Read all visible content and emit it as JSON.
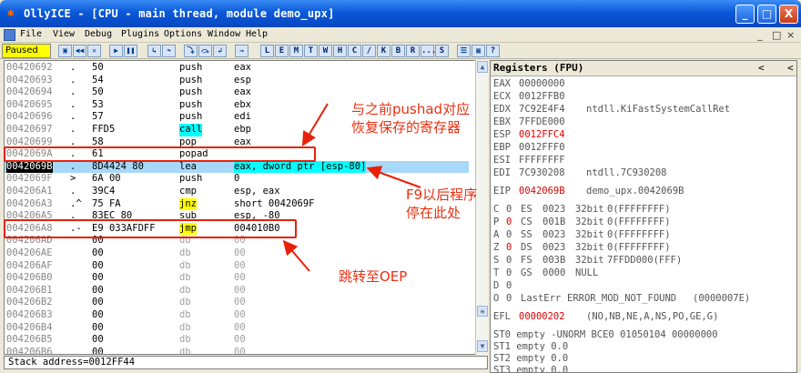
{
  "window": {
    "title": "OllyICE - [CPU - main thread, module demo_upx]",
    "min": "_",
    "max": "□",
    "close": "X"
  },
  "menu": {
    "items": [
      "File",
      "View",
      "Debug",
      "Plugins",
      "Options",
      "Window",
      "Help"
    ],
    "mdi_controls": [
      "_",
      "□",
      "×"
    ]
  },
  "toolbar": {
    "status": "Paused",
    "buttons": [
      "open",
      "restart",
      "close",
      "run",
      "pause",
      "step-into",
      "step-over",
      "trace-into",
      "trace-over",
      "execute-till-return",
      "go-to"
    ],
    "letters": [
      "L",
      "E",
      "M",
      "T",
      "W",
      "H",
      "C",
      "/",
      "K",
      "B",
      "R",
      "...",
      "S"
    ],
    "extra": [
      "list",
      "grid",
      "?"
    ]
  },
  "disasm": {
    "rows": [
      {
        "addr": "00420692",
        "mark": ".",
        "hex": "50",
        "mnem": "push",
        "ops": "eax"
      },
      {
        "addr": "00420693",
        "mark": ".",
        "hex": "54",
        "mnem": "push",
        "ops": "esp"
      },
      {
        "addr": "00420694",
        "mark": ".",
        "hex": "50",
        "mnem": "push",
        "ops": "eax"
      },
      {
        "addr": "00420695",
        "mark": ".",
        "hex": "53",
        "mnem": "push",
        "ops": "ebx"
      },
      {
        "addr": "00420696",
        "mark": ".",
        "hex": "57",
        "mnem": "push",
        "ops": "edi"
      },
      {
        "addr": "00420697",
        "mark": ".",
        "hex": "FFD5",
        "mnem": "call",
        "ops": "ebp"
      },
      {
        "addr": "00420699",
        "mark": ".",
        "hex": "58",
        "mnem": "pop",
        "ops": "eax"
      },
      {
        "addr": "0042069A",
        "mark": ".",
        "hex": "61",
        "mnem": "popad",
        "ops": ""
      },
      {
        "addr": "0042069B",
        "mark": ".",
        "hex": "8D4424 80",
        "mnem": "lea",
        "ops": "eax, dword ptr [esp-80]"
      },
      {
        "addr": "0042069F",
        "mark": ">",
        "hex": "6A 00",
        "mnem": "push",
        "ops": "0"
      },
      {
        "addr": "004206A1",
        "mark": ".",
        "hex": "39C4",
        "mnem": "cmp",
        "ops": "esp, eax"
      },
      {
        "addr": "004206A3",
        "mark": ".^",
        "hex": "75 FA",
        "mnem": "jnz",
        "ops": "short 0042069F"
      },
      {
        "addr": "004206A5",
        "mark": ".",
        "hex": "83EC 80",
        "mnem": "sub",
        "ops": "esp, -80"
      },
      {
        "addr": "004206A8",
        "mark": ".-",
        "hex": "E9 033AFDFF",
        "mnem": "jmp",
        "ops": "004010B0"
      },
      {
        "addr": "004206AD",
        "mark": "",
        "hex": "00",
        "mnem": "db",
        "ops": "00"
      },
      {
        "addr": "004206AE",
        "mark": "",
        "hex": "00",
        "mnem": "db",
        "ops": "00"
      },
      {
        "addr": "004206AF",
        "mark": "",
        "hex": "00",
        "mnem": "db",
        "ops": "00"
      },
      {
        "addr": "004206B0",
        "mark": "",
        "hex": "00",
        "mnem": "db",
        "ops": "00"
      },
      {
        "addr": "004206B1",
        "mark": "",
        "hex": "00",
        "mnem": "db",
        "ops": "00"
      },
      {
        "addr": "004206B2",
        "mark": "",
        "hex": "00",
        "mnem": "db",
        "ops": "00"
      },
      {
        "addr": "004206B3",
        "mark": "",
        "hex": "00",
        "mnem": "db",
        "ops": "00"
      },
      {
        "addr": "004206B4",
        "mark": "",
        "hex": "00",
        "mnem": "db",
        "ops": "00"
      },
      {
        "addr": "004206B5",
        "mark": "",
        "hex": "00",
        "mnem": "db",
        "ops": "00"
      },
      {
        "addr": "004206B6",
        "mark": "",
        "hex": "00",
        "mnem": "db",
        "ops": "00"
      }
    ]
  },
  "statusline": "Stack address=0012FF44",
  "registers": {
    "title": "Registers (FPU)",
    "nav_left": "<",
    "nav_right": "<",
    "gp": [
      {
        "name": "EAX",
        "value": "00000000",
        "comment": "",
        "changed": false
      },
      {
        "name": "ECX",
        "value": "0012FFB0",
        "comment": "",
        "changed": false
      },
      {
        "name": "EDX",
        "value": "7C92E4F4",
        "comment": "ntdll.KiFastSystemCallRet",
        "changed": false
      },
      {
        "name": "EBX",
        "value": "7FFDE000",
        "comment": "",
        "changed": false
      },
      {
        "name": "ESP",
        "value": "0012FFC4",
        "comment": "",
        "changed": true
      },
      {
        "name": "EBP",
        "value": "0012FFF0",
        "comment": "",
        "changed": false
      },
      {
        "name": "ESI",
        "value": "FFFFFFFF",
        "comment": "",
        "changed": false
      },
      {
        "name": "EDI",
        "value": "7C930208",
        "comment": "ntdll.7C930208",
        "changed": false
      }
    ],
    "eip": {
      "name": "EIP",
      "value": "0042069B",
      "comment": "demo_upx.0042069B"
    },
    "flags": [
      {
        "f": "C",
        "v": "0",
        "seg": "ES",
        "sel": "0023",
        "bits": "32bit",
        "range": "0(FFFFFFFF)",
        "changed": false
      },
      {
        "f": "P",
        "v": "0",
        "seg": "CS",
        "sel": "001B",
        "bits": "32bit",
        "range": "0(FFFFFFFF)",
        "changed": true
      },
      {
        "f": "A",
        "v": "0",
        "seg": "SS",
        "sel": "0023",
        "bits": "32bit",
        "range": "0(FFFFFFFF)",
        "changed": false
      },
      {
        "f": "Z",
        "v": "0",
        "seg": "DS",
        "sel": "0023",
        "bits": "32bit",
        "range": "0(FFFFFFFF)",
        "changed": true
      },
      {
        "f": "S",
        "v": "0",
        "seg": "FS",
        "sel": "003B",
        "bits": "32bit",
        "range": "7FFDD000(FFF)",
        "changed": false
      },
      {
        "f": "T",
        "v": "0",
        "seg": "GS",
        "sel": "0000",
        "bits": "NULL",
        "range": "",
        "changed": false
      },
      {
        "f": "D",
        "v": "0",
        "seg": "",
        "sel": "",
        "bits": "",
        "range": "",
        "changed": false
      },
      {
        "f": "O",
        "v": "0",
        "seg": "LastErr",
        "sel": "ERROR_MOD_NOT_FOUND",
        "bits": "(0000007E)",
        "range": "",
        "changed": false
      }
    ],
    "efl": {
      "name": "EFL",
      "value": "00000202",
      "comment": "(NO,NB,NE,A,NS,PO,GE,G)"
    },
    "fpu": [
      "ST0 empty -UNORM BCE0 01050104 00000000",
      "ST1 empty 0.0",
      "ST2 empty 0.0",
      "ST3 empty 0.0"
    ]
  },
  "annotations": {
    "pushad": "与之前pushad对应\n恢复保存的寄存器",
    "f9": "F9以后程序\n停在此处",
    "oep": "跳转至OEP"
  },
  "colors": {
    "annotation": "#e83010",
    "current_row": "#000000",
    "selected_row": "#a8d8f8",
    "changed_value": "#e00000"
  }
}
